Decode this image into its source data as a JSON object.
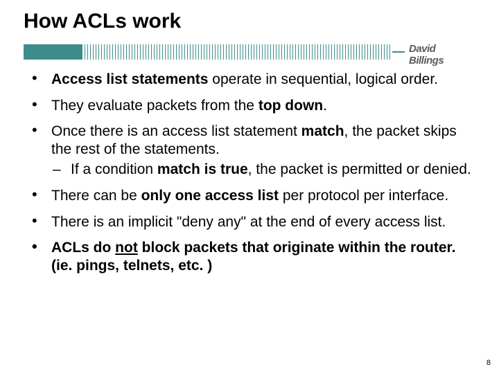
{
  "title": "How ACLs work",
  "author": "David Billings",
  "pageNumber": "8",
  "bullets": {
    "b1_a": "Access list statements",
    "b1_b": " operate in sequential, logical order.",
    "b2_a": "They evaluate packets from the ",
    "b2_b": "top down",
    "b2_c": ".",
    "b3_a": "Once there is an access list statement ",
    "b3_b": "match",
    "b3_c": ", the packet skips the rest of the statements.",
    "b3_sub_a": "If a condition ",
    "b3_sub_b": "match is true",
    "b3_sub_c": ", the packet is permitted or denied.",
    "b4_a": "There can be ",
    "b4_b": "only one access list",
    "b4_c": " per protocol per interface.",
    "b5": "There is an implicit \"deny any\" at the end of every access list.",
    "b6_a": "ACLs do ",
    "b6_b": "not",
    "b6_c": " block packets that originate within the router.  (ie. pings, telnets, etc. )"
  }
}
